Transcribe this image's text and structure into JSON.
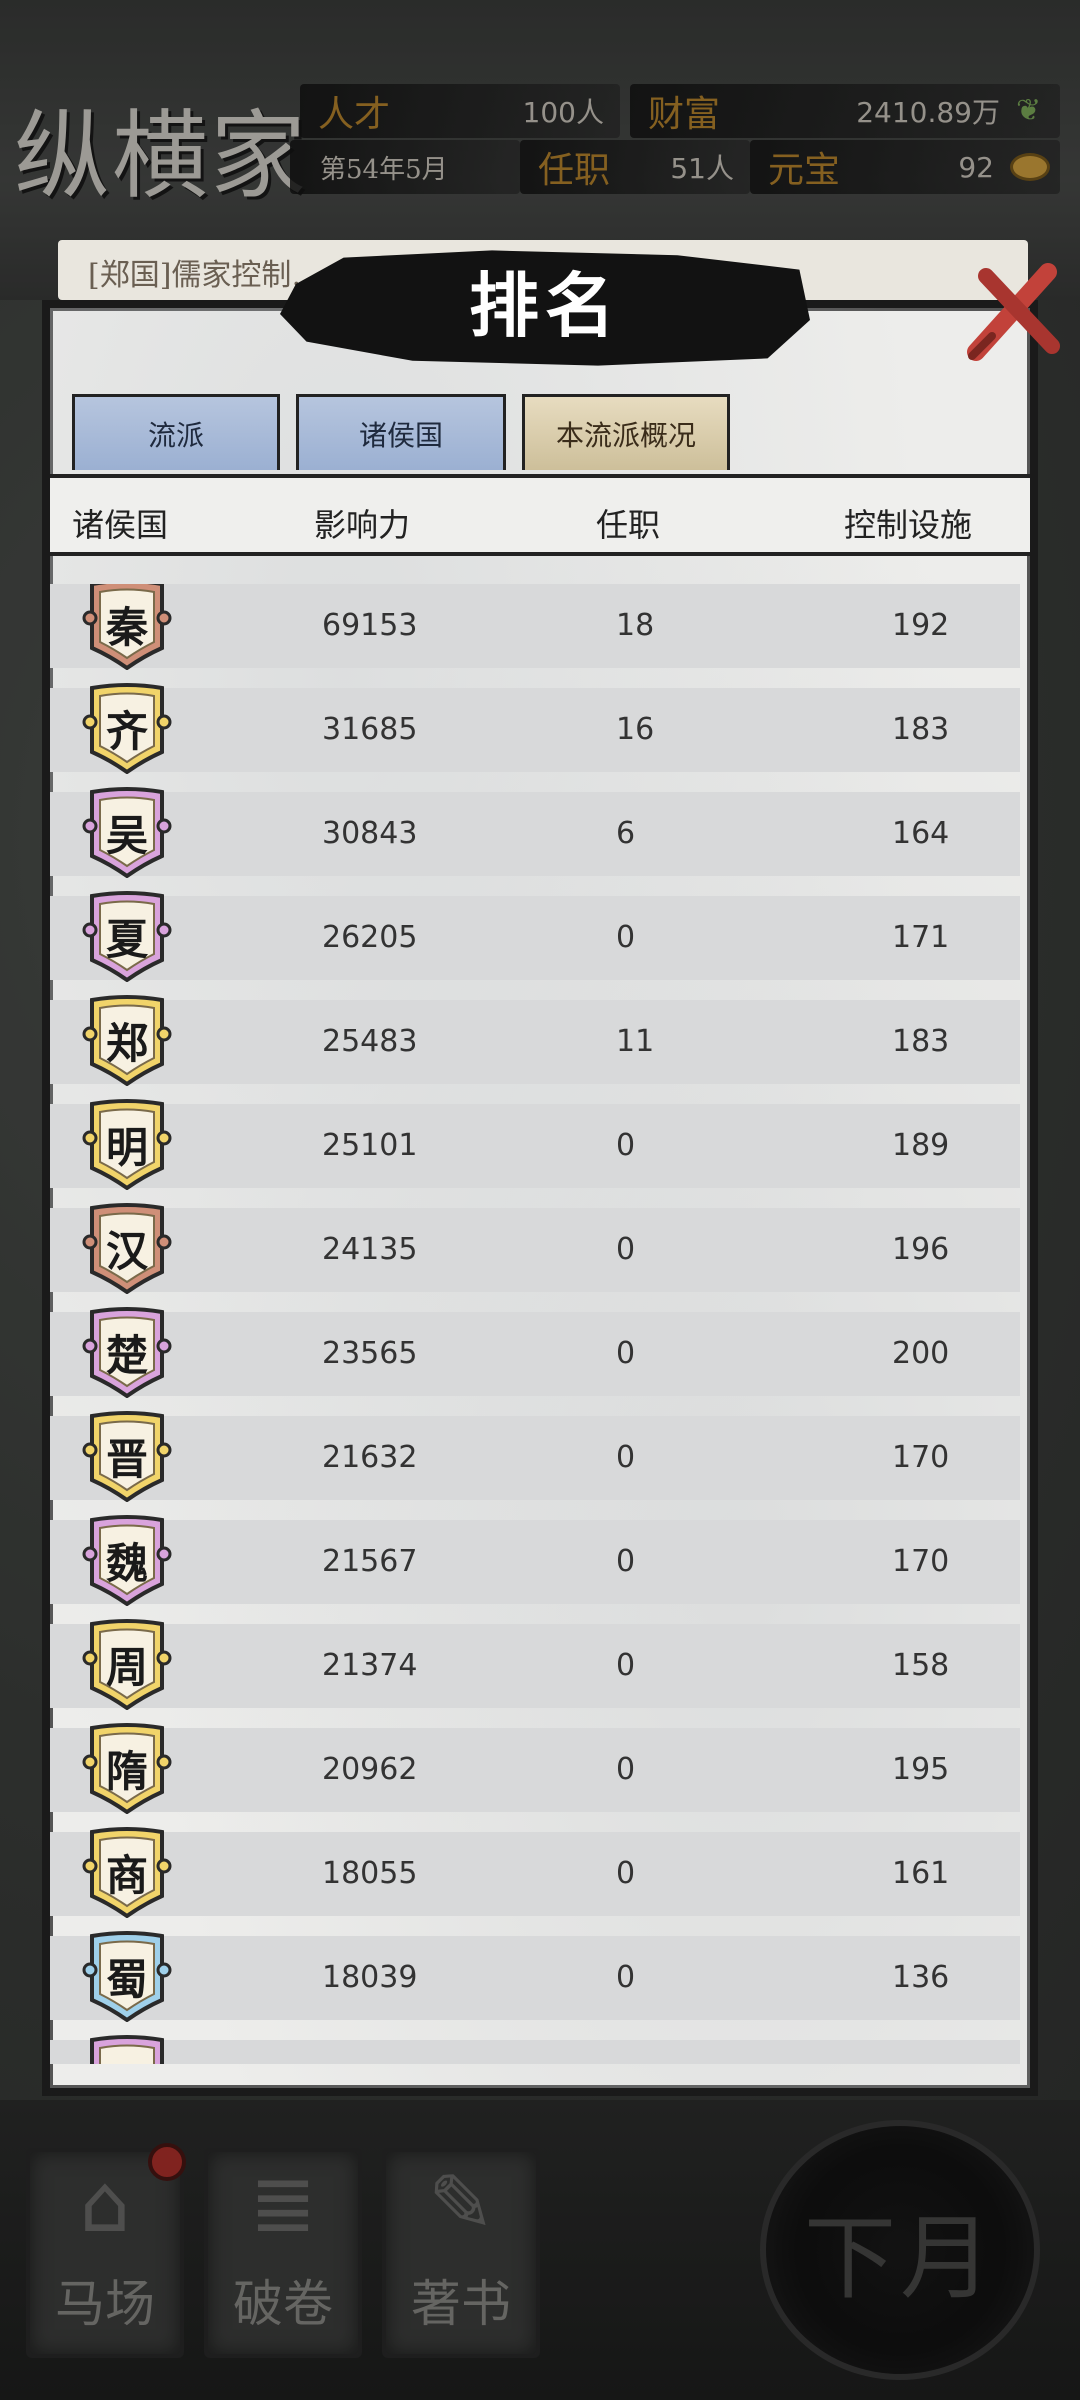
{
  "hud": {
    "title": "纵横家",
    "talent_label": "人才",
    "talent_value": "100人",
    "wealth_label": "财富",
    "wealth_value": "2410.89万",
    "date": "第54年5月",
    "office_label": "任职",
    "office_value": "51人",
    "ingot_label": "元宝",
    "ingot_value": "92"
  },
  "notice": "[郑国]儒家控制……纵横家影",
  "panel": {
    "title": "排名",
    "tabs": [
      {
        "label": "流派",
        "active": false
      },
      {
        "label": "诸侯国",
        "active": false
      },
      {
        "label": "本流派概况",
        "active": true
      }
    ],
    "columns": [
      "诸侯国",
      "影响力",
      "任职",
      "控制设施"
    ]
  },
  "rows": [
    {
      "state": "秦",
      "influence": "69153",
      "office": "18",
      "facilities": "192",
      "banner": "#cf8f78"
    },
    {
      "state": "齐",
      "influence": "31685",
      "office": "16",
      "facilities": "183",
      "banner": "#f1d46a"
    },
    {
      "state": "吴",
      "influence": "30843",
      "office": "6",
      "facilities": "164",
      "banner": "#d9a3dc"
    },
    {
      "state": "夏",
      "influence": "26205",
      "office": "0",
      "facilities": "171",
      "banner": "#d9a3dc"
    },
    {
      "state": "郑",
      "influence": "25483",
      "office": "11",
      "facilities": "183",
      "banner": "#f1d46a"
    },
    {
      "state": "明",
      "influence": "25101",
      "office": "0",
      "facilities": "189",
      "banner": "#f1d46a"
    },
    {
      "state": "汉",
      "influence": "24135",
      "office": "0",
      "facilities": "196",
      "banner": "#cf8f78"
    },
    {
      "state": "楚",
      "influence": "23565",
      "office": "0",
      "facilities": "200",
      "banner": "#d9a3dc"
    },
    {
      "state": "晋",
      "influence": "21632",
      "office": "0",
      "facilities": "170",
      "banner": "#f1d46a"
    },
    {
      "state": "魏",
      "influence": "21567",
      "office": "0",
      "facilities": "170",
      "banner": "#d9a3dc"
    },
    {
      "state": "周",
      "influence": "21374",
      "office": "0",
      "facilities": "158",
      "banner": "#f1d46a"
    },
    {
      "state": "隋",
      "influence": "20962",
      "office": "0",
      "facilities": "195",
      "banner": "#f1d46a"
    },
    {
      "state": "商",
      "influence": "18055",
      "office": "0",
      "facilities": "161",
      "banner": "#f1d46a"
    },
    {
      "state": "蜀",
      "influence": "18039",
      "office": "0",
      "facilities": "136",
      "banner": "#9fd0ea"
    },
    {
      "state": "",
      "influence": "",
      "office": "",
      "facilities": "",
      "banner": "#d9a3dc"
    }
  ],
  "actions": {
    "horse": "马场",
    "scroll": "破卷",
    "write": "著书",
    "next_month": "下月"
  },
  "colors": {
    "tab_inactive": "#9bb0d2",
    "tab_active": "#cdbf9a",
    "row_bg": "#d8d9da",
    "close_red": "#c2423a"
  }
}
